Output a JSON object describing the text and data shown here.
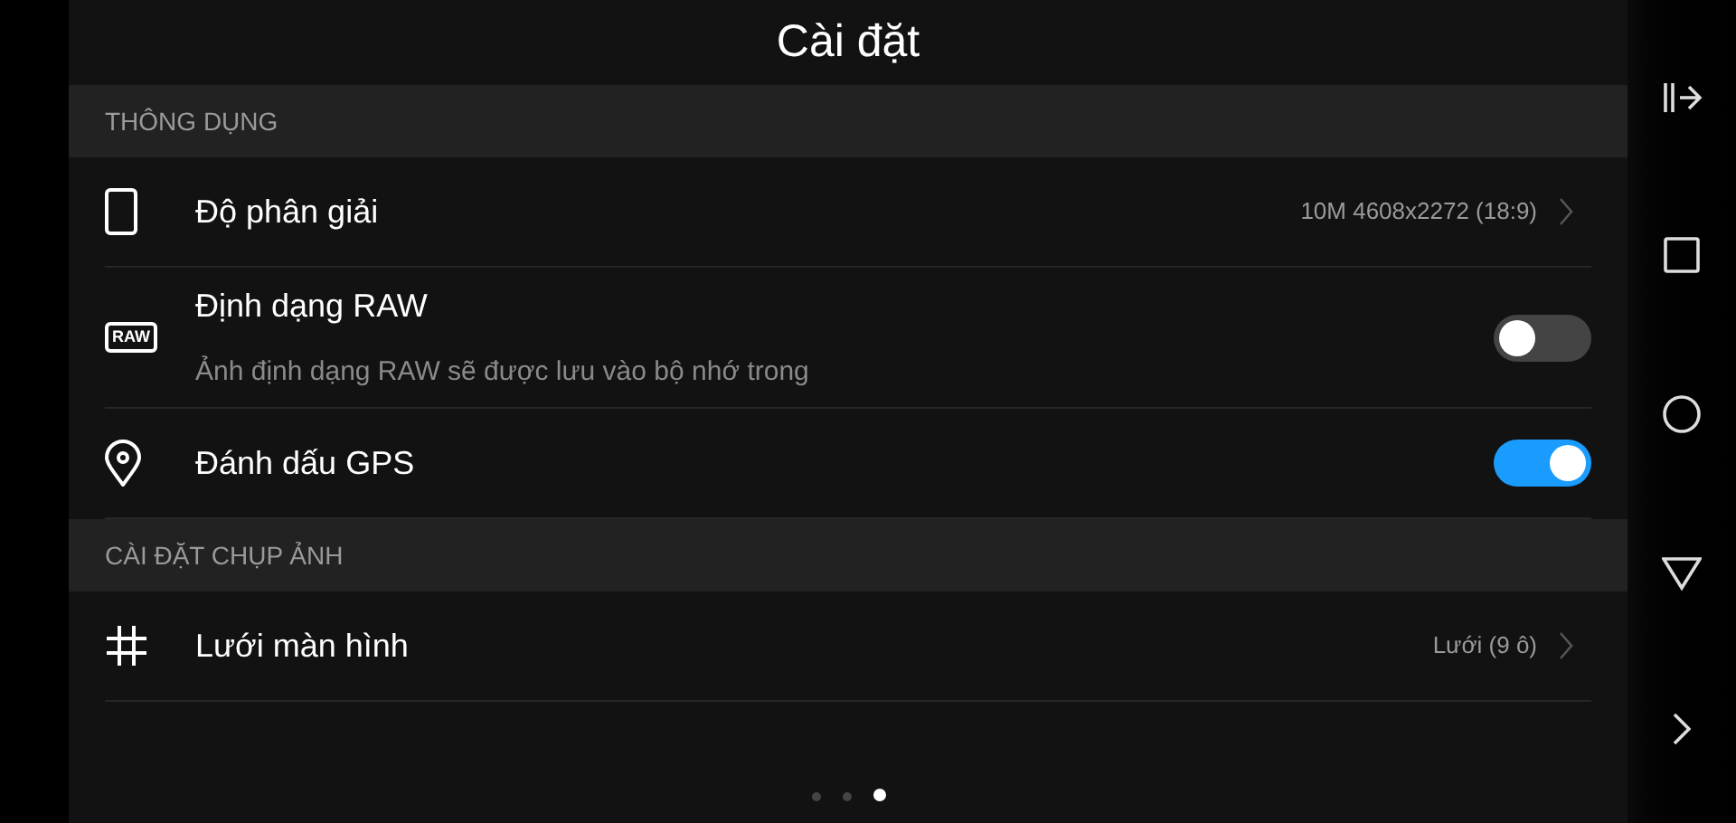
{
  "title": "Cài đặt",
  "sections": [
    {
      "header": "THÔNG DỤNG",
      "items": [
        {
          "kind": "value",
          "label": "Độ phân giải",
          "value": "10M 4608x2272 (18:9)"
        },
        {
          "kind": "toggle",
          "badge": "RAW",
          "label": "Định dạng RAW",
          "description": "Ảnh định dạng RAW sẽ được lưu vào bộ nhớ trong",
          "on": false
        },
        {
          "kind": "toggle",
          "label": "Đánh dấu GPS",
          "on": true
        }
      ]
    },
    {
      "header": "CÀI ĐẶT CHỤP ẢNH",
      "items": [
        {
          "kind": "value",
          "label": "Lưới màn hình",
          "value": "Lưới (9 ô)"
        }
      ]
    }
  ],
  "pages": [
    {
      "selected": false
    },
    {
      "selected": false
    },
    {
      "selected": true
    }
  ]
}
